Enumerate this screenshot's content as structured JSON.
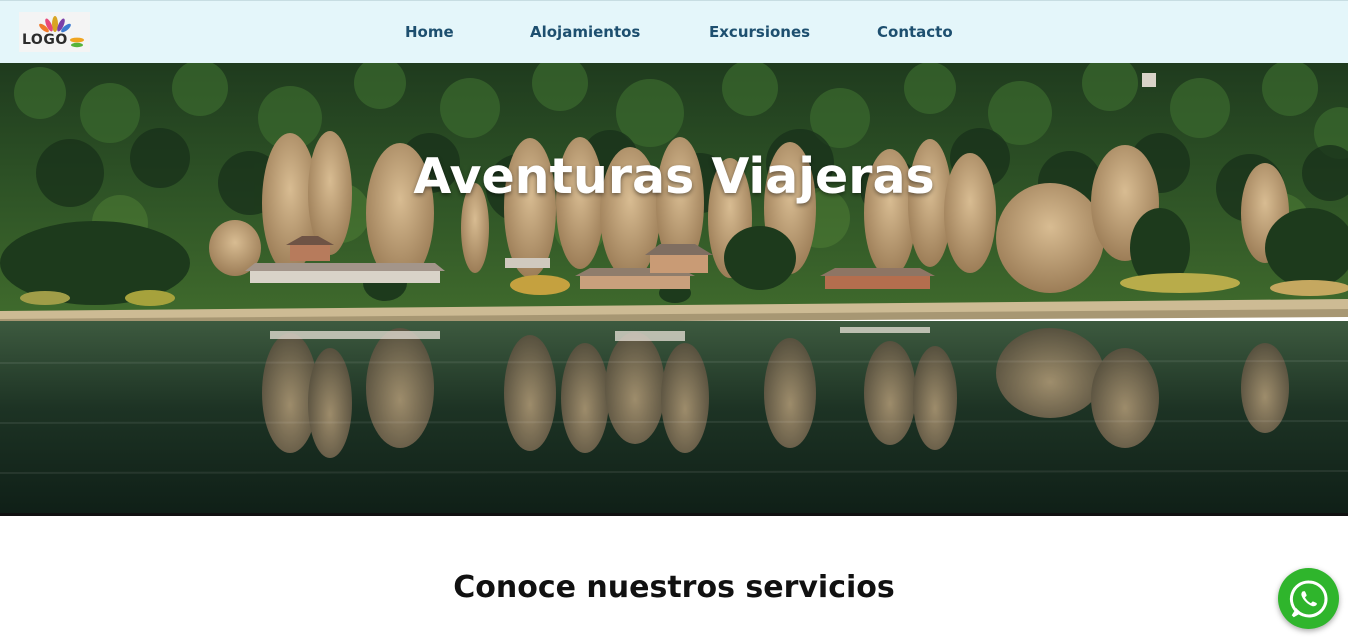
{
  "logo": {
    "text": "LOGO",
    "icon": "lotus-icon"
  },
  "nav": {
    "items": [
      {
        "label": "Home"
      },
      {
        "label": "Alojamientos"
      },
      {
        "label": "Excursiones"
      },
      {
        "label": "Contacto"
      }
    ]
  },
  "hero": {
    "title": "Aventuras Viajeras",
    "image": "lake-forest-village-photo"
  },
  "services": {
    "heading": "Conoce nuestros servicios"
  },
  "whatsapp": {
    "icon": "whatsapp-icon",
    "color": "#2fb52c"
  },
  "colors": {
    "navbar_bg": "#e4f6fa",
    "nav_text": "#1d4f6f"
  }
}
